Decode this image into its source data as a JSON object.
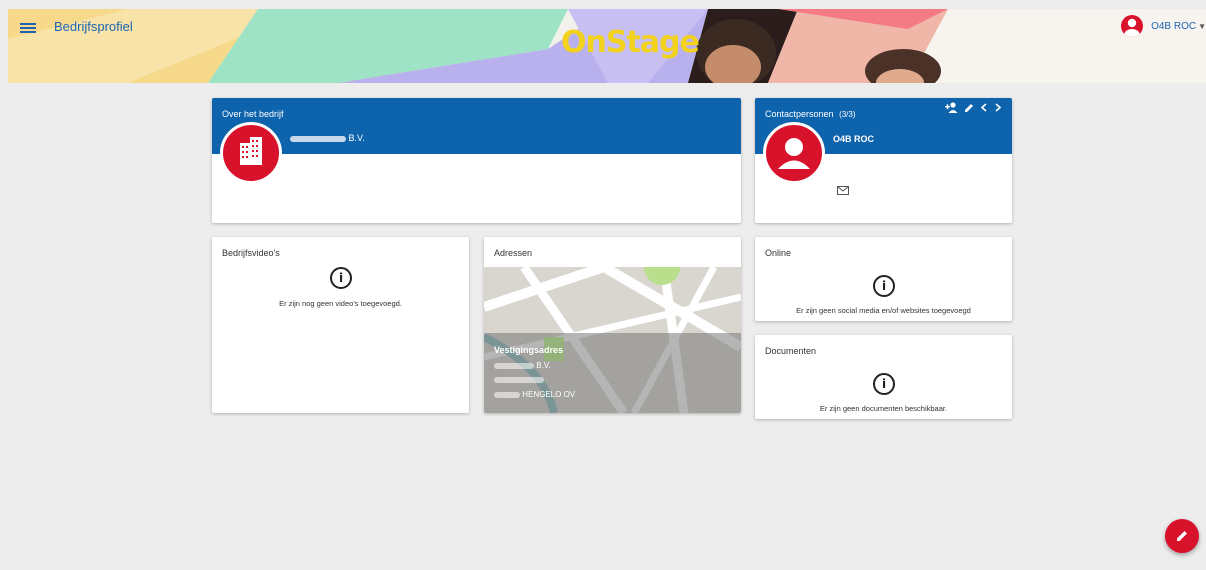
{
  "header": {
    "title": "Bedrijfsprofiel",
    "logo": "OnStage",
    "user_label": "O4B ROC",
    "colors": {
      "brand_blue": "#0e63ad",
      "accent_red": "#d9122b",
      "logo_yellow": "#f2d21c"
    }
  },
  "about": {
    "title": "Over het bedrijf",
    "company_suffix": "B.V.",
    "avatar_icon": "building-icon"
  },
  "contacts": {
    "title": "Contactpersonen",
    "count": "(3/3)",
    "name": "O4B ROC",
    "icons": [
      "add-person-icon",
      "edit-icon",
      "chevron-left-icon",
      "chevron-right-icon",
      "mail-icon"
    ]
  },
  "videos": {
    "title": "Bedrijfsvideo's",
    "empty_text": "Er zijn nog geen video's toegevoegd."
  },
  "addresses": {
    "title": "Adressen",
    "overlay_title": "Vestigingsadres",
    "company_suffix": "B.V.",
    "city": "HENGELO OV"
  },
  "online": {
    "title": "Online",
    "empty_text": "Er zijn geen social media en/of websites toegevoegd"
  },
  "documents": {
    "title": "Documenten",
    "empty_text": "Er zijn geen documenten beschikbaar."
  }
}
